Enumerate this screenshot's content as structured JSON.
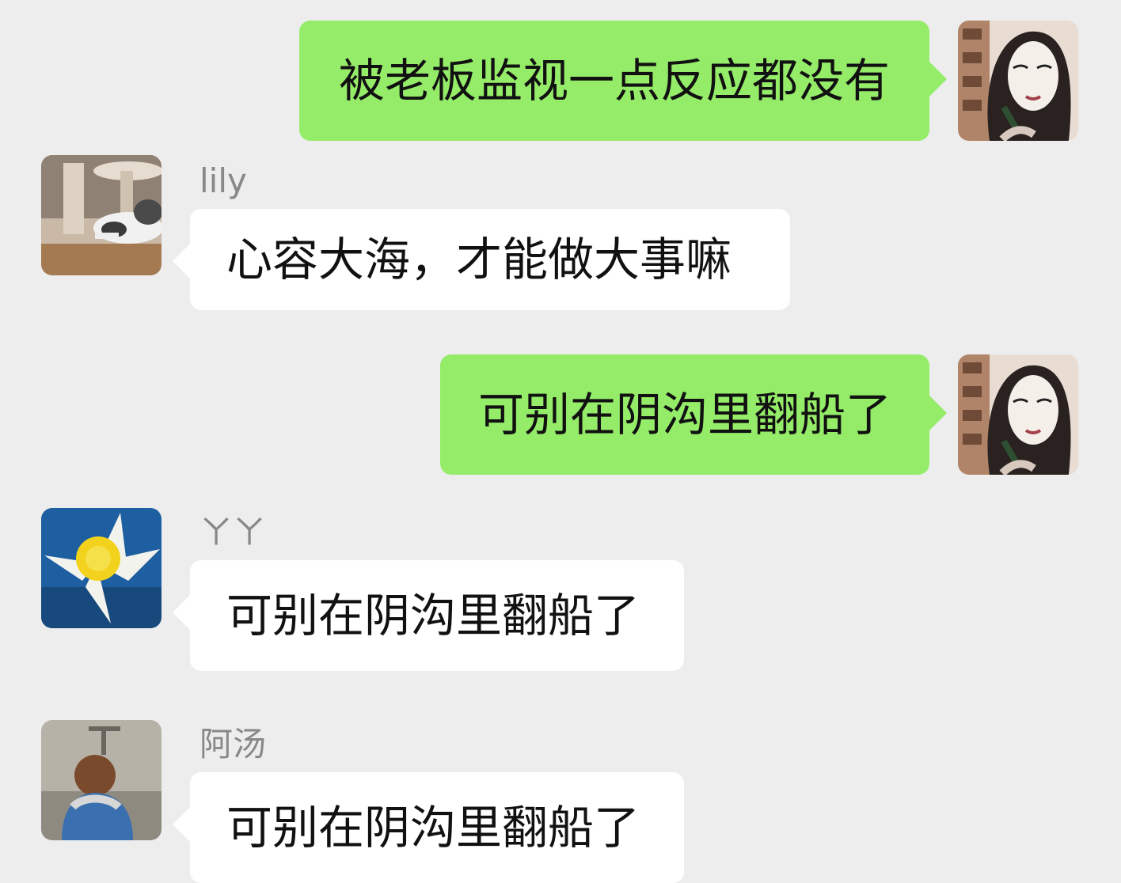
{
  "colors": {
    "background": "#ededed",
    "outgoing_bubble": "#95ec69",
    "incoming_bubble": "#ffffff",
    "sender_name": "#888888"
  },
  "messages": [
    {
      "direction": "outgoing",
      "text": "被老板监视一点反应都没有",
      "avatar": "self-avatar"
    },
    {
      "direction": "incoming",
      "sender": "lily",
      "text": "心容大海，才能做大事嘛",
      "avatar": "cat-avatar"
    },
    {
      "direction": "outgoing",
      "text": "可别在阴沟里翻船了",
      "avatar": "self-avatar"
    },
    {
      "direction": "incoming",
      "sender": "ㄚㄚ",
      "text": "可别在阴沟里翻船了",
      "avatar": "daffodil-avatar"
    },
    {
      "direction": "incoming",
      "sender": "阿汤",
      "text": "可别在阴沟里翻船了",
      "avatar": "child-avatar"
    }
  ]
}
